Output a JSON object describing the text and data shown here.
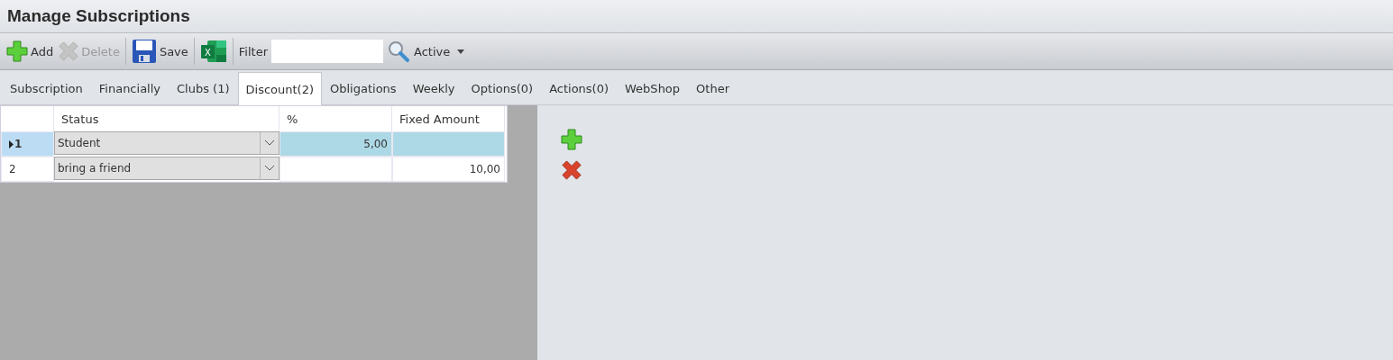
{
  "window": {
    "title": "Manage Subscriptions"
  },
  "toolbar": {
    "buttons": [
      {
        "kind": "add",
        "label": "Add",
        "disabled": false
      },
      {
        "kind": "delete",
        "label": "Delete",
        "disabled": true
      },
      {
        "kind": "save",
        "label": "Save",
        "disabled": false
      },
      {
        "kind": "excel",
        "label": "X",
        "disabled": false
      }
    ],
    "filter": {
      "label": "Filter"
    },
    "status_dropdown": {
      "value": "Active"
    }
  },
  "tabs": [
    {
      "label": "Subscription",
      "selected": false
    },
    {
      "label": "Financially",
      "selected": false
    },
    {
      "label": "Clubs (1)",
      "selected": false
    },
    {
      "label": "Discount(2)",
      "selected": true
    },
    {
      "label": "Obligations",
      "selected": false
    },
    {
      "label": "Weekly",
      "selected": false
    },
    {
      "label": "Options(0)",
      "selected": false
    },
    {
      "label": "Actions(0)",
      "selected": false
    },
    {
      "label": "WebShop",
      "selected": false
    },
    {
      "label": "Other",
      "selected": false
    }
  ],
  "table": {
    "columns": [
      "Status",
      "%",
      "Fixed Amount"
    ],
    "rows": [
      {
        "number": "1",
        "status": "Student",
        "percent": "5,00",
        "selected": true
      },
      {
        "number": "2",
        "status": "bring a friend",
        "fixed_amount": "10,00",
        "selected": false
      }
    ]
  }
}
